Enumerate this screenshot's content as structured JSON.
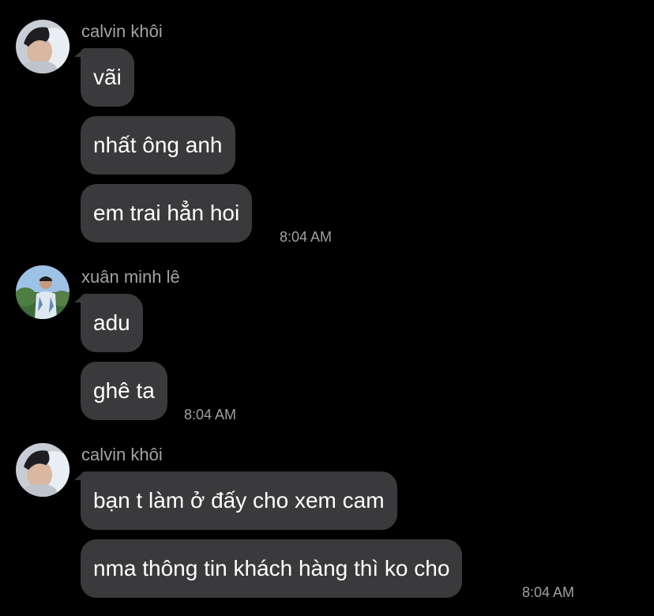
{
  "colors": {
    "background": "#000000",
    "bubble": "#3a3a3c",
    "text": "#ffffff",
    "muted": "#a3a3a3"
  },
  "groups": [
    {
      "sender": "calvin khôi",
      "avatar_icon": "avatar-calvin",
      "messages": [
        "vãi",
        "nhất ông anh",
        "em trai hẳn hoi"
      ],
      "time": "8:04 AM"
    },
    {
      "sender": "xuân minh lê",
      "avatar_icon": "avatar-xuan",
      "messages": [
        "adu",
        "ghê ta"
      ],
      "time": "8:04 AM"
    },
    {
      "sender": "calvin khôi",
      "avatar_icon": "avatar-calvin",
      "messages": [
        "bạn t làm ở đấy cho xem cam",
        "nma thông tin khách hàng thì ko cho"
      ],
      "time": "8:04 AM"
    }
  ]
}
